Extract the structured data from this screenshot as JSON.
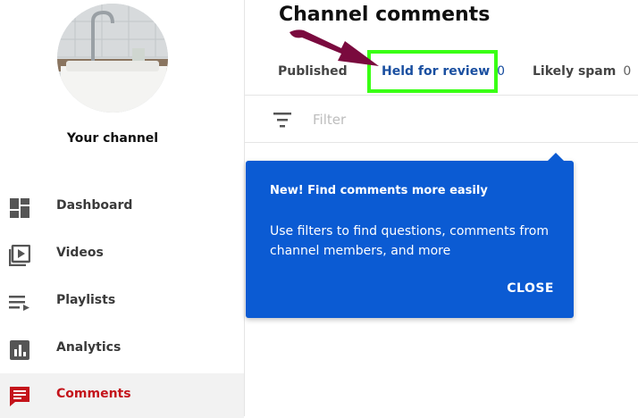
{
  "sidebar": {
    "channel_name": "Your channel",
    "items": [
      {
        "label": "Dashboard",
        "icon": "dashboard-icon"
      },
      {
        "label": "Videos",
        "icon": "video-icon"
      },
      {
        "label": "Playlists",
        "icon": "playlist-icon"
      },
      {
        "label": "Analytics",
        "icon": "analytics-icon"
      },
      {
        "label": "Comments",
        "icon": "comments-icon",
        "active": true
      }
    ]
  },
  "main": {
    "title": "Channel comments",
    "tabs": [
      {
        "label": "Published",
        "count": ""
      },
      {
        "label": "Held for review",
        "count": "0"
      },
      {
        "label": "Likely spam",
        "count": "0"
      }
    ],
    "filter": {
      "placeholder": "Filter"
    },
    "popup": {
      "title": "New! Find comments more easily",
      "body": "Use filters to find questions, comments from channel members, and more",
      "close_label": "CLOSE"
    }
  },
  "colors": {
    "accent_blue": "#0b5bd3",
    "active_red": "#c4141b",
    "highlight_green": "#39ff14",
    "annotation_arrow": "#7a0a3e"
  }
}
